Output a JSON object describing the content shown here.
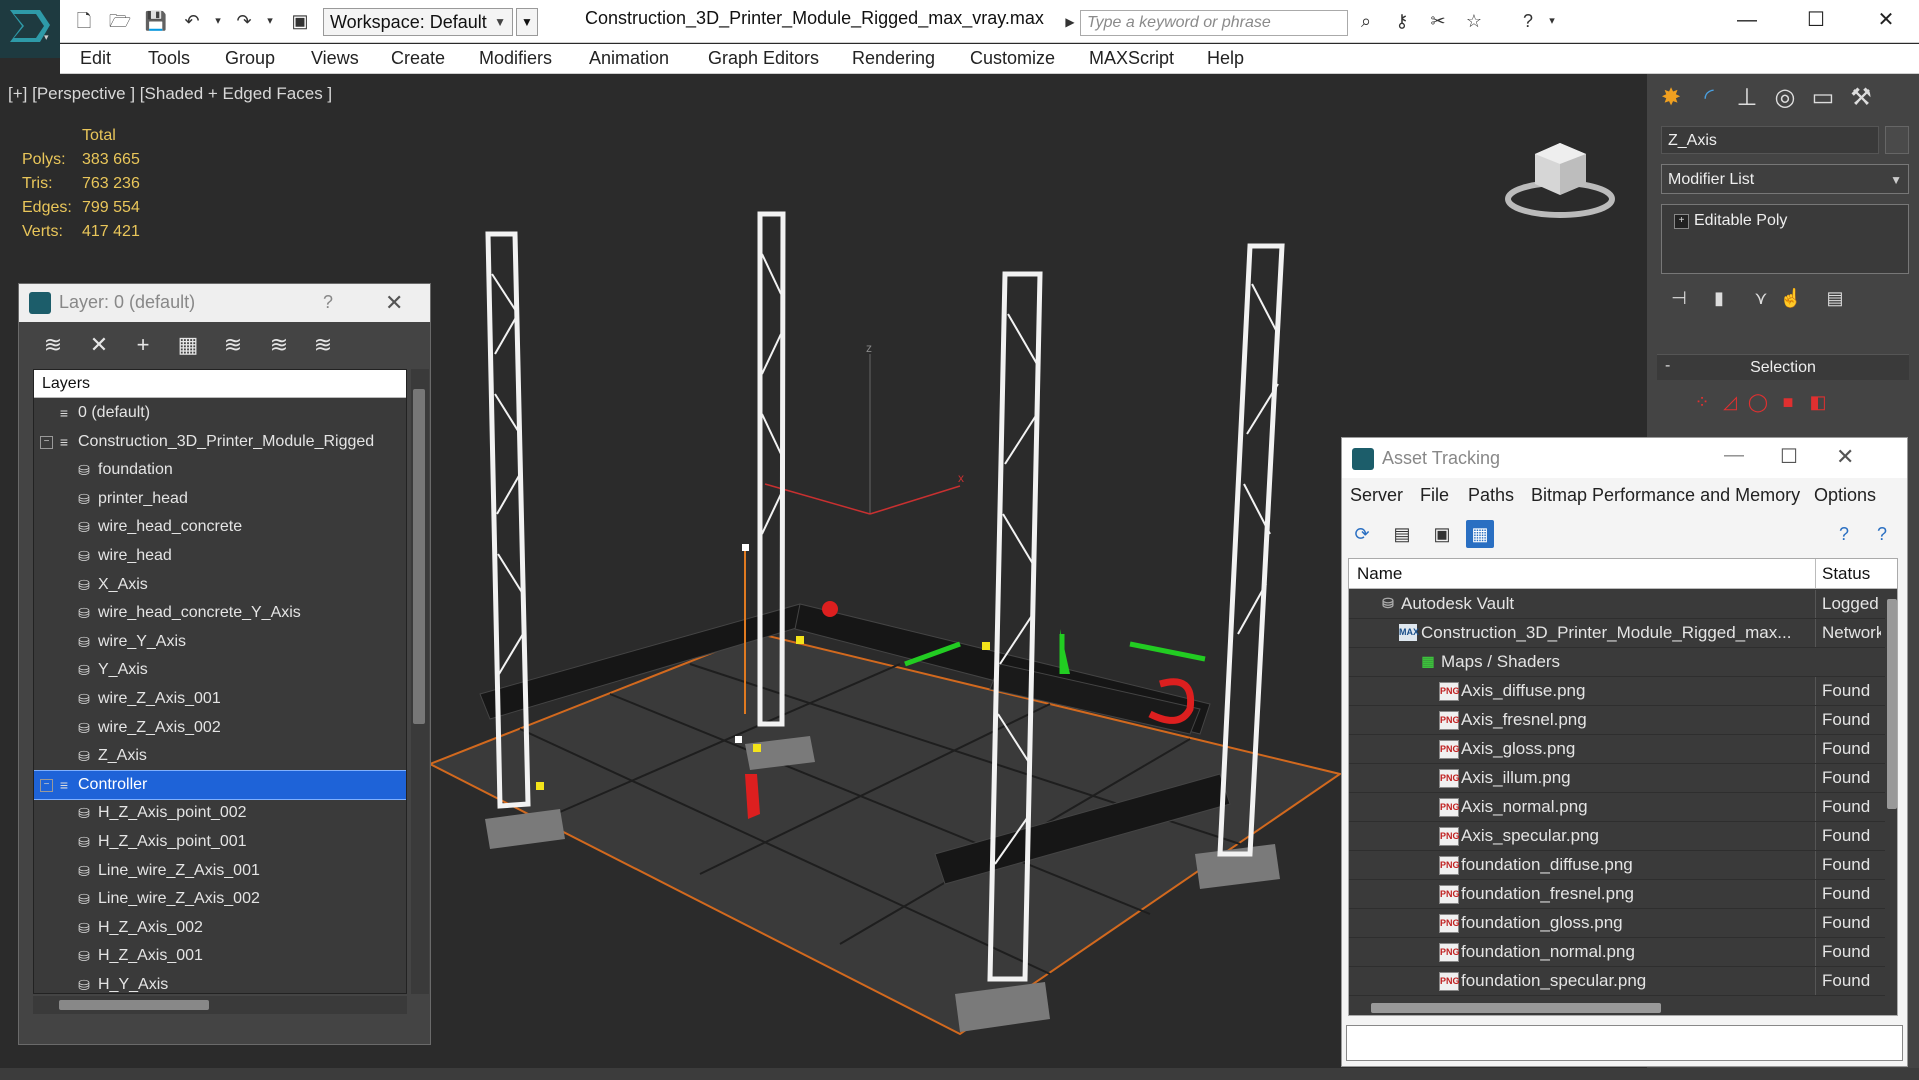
{
  "app": {
    "document_title": "Construction_3D_Printer_Module_Rigged_max_vray.max",
    "workspace": "Workspace: Default",
    "search_placeholder": "Type a keyword or phrase"
  },
  "menu": [
    "Edit",
    "Tools",
    "Group",
    "Views",
    "Create",
    "Modifiers",
    "Animation",
    "Graph Editors",
    "Rendering",
    "Customize",
    "MAXScript",
    "Help"
  ],
  "viewport": {
    "label": "[+] [Perspective ] [Shaded + Edged Faces ]",
    "stats_header": "Total",
    "stats": [
      {
        "key": "Polys:",
        "value": "383 665"
      },
      {
        "key": "Tris:",
        "value": "763 236"
      },
      {
        "key": "Edges:",
        "value": "799 554"
      },
      {
        "key": "Verts:",
        "value": "417 421"
      }
    ],
    "axis_z": "z",
    "axis_x": "x"
  },
  "layer_dialog": {
    "title": "Layer: 0 (default)",
    "help": "?",
    "column": "Layers",
    "rows": [
      {
        "label": "0 (default)",
        "level": 0,
        "expander": "",
        "selected": false
      },
      {
        "label": "Construction_3D_Printer_Module_Rigged",
        "level": 0,
        "expander": "−",
        "selected": false
      },
      {
        "label": "foundation",
        "level": 1,
        "expander": "",
        "selected": false
      },
      {
        "label": "printer_head",
        "level": 1,
        "expander": "",
        "selected": false
      },
      {
        "label": "wire_head_concrete",
        "level": 1,
        "expander": "",
        "selected": false
      },
      {
        "label": "wire_head",
        "level": 1,
        "expander": "",
        "selected": false
      },
      {
        "label": "X_Axis",
        "level": 1,
        "expander": "",
        "selected": false
      },
      {
        "label": "wire_head_concrete_Y_Axis",
        "level": 1,
        "expander": "",
        "selected": false
      },
      {
        "label": "wire_Y_Axis",
        "level": 1,
        "expander": "",
        "selected": false
      },
      {
        "label": "Y_Axis",
        "level": 1,
        "expander": "",
        "selected": false
      },
      {
        "label": "wire_Z_Axis_001",
        "level": 1,
        "expander": "",
        "selected": false
      },
      {
        "label": "wire_Z_Axis_002",
        "level": 1,
        "expander": "",
        "selected": false
      },
      {
        "label": "Z_Axis",
        "level": 1,
        "expander": "",
        "selected": false
      },
      {
        "label": "Controller",
        "level": 0,
        "expander": "−",
        "selected": true
      },
      {
        "label": "H_Z_Axis_point_002",
        "level": 1,
        "expander": "",
        "selected": false
      },
      {
        "label": "H_Z_Axis_point_001",
        "level": 1,
        "expander": "",
        "selected": false
      },
      {
        "label": "Line_wire_Z_Axis_001",
        "level": 1,
        "expander": "",
        "selected": false
      },
      {
        "label": "Line_wire_Z_Axis_002",
        "level": 1,
        "expander": "",
        "selected": false
      },
      {
        "label": "H_Z_Axis_002",
        "level": 1,
        "expander": "",
        "selected": false
      },
      {
        "label": "H_Z_Axis_001",
        "level": 1,
        "expander": "",
        "selected": false
      },
      {
        "label": "H_Y_Axis",
        "level": 1,
        "expander": "",
        "selected": false
      }
    ]
  },
  "command_panel": {
    "object_name": "Z_Axis",
    "modifier_list": "Modifier List",
    "stack_item": "Editable Poly",
    "selection_rollout": "Selection"
  },
  "asset_tracking": {
    "title": "Asset Tracking",
    "menu": [
      "Server",
      "File",
      "Paths",
      "Bitmap Performance and Memory",
      "Options"
    ],
    "columns": {
      "name": "Name",
      "status": "Status"
    },
    "rows": [
      {
        "name": "Autodesk Vault",
        "status": "Logged",
        "indent": 0,
        "icon": "vault"
      },
      {
        "name": "Construction_3D_Printer_Module_Rigged_max...",
        "status": "Network",
        "indent": 1,
        "icon": "max"
      },
      {
        "name": "Maps / Shaders",
        "status": "",
        "indent": 2,
        "icon": "maps"
      },
      {
        "name": "Axis_diffuse.png",
        "status": "Found",
        "indent": 3,
        "icon": "png"
      },
      {
        "name": "Axis_fresnel.png",
        "status": "Found",
        "indent": 3,
        "icon": "png"
      },
      {
        "name": "Axis_gloss.png",
        "status": "Found",
        "indent": 3,
        "icon": "png"
      },
      {
        "name": "Axis_illum.png",
        "status": "Found",
        "indent": 3,
        "icon": "png"
      },
      {
        "name": "Axis_normal.png",
        "status": "Found",
        "indent": 3,
        "icon": "png"
      },
      {
        "name": "Axis_specular.png",
        "status": "Found",
        "indent": 3,
        "icon": "png"
      },
      {
        "name": "foundation_diffuse.png",
        "status": "Found",
        "indent": 3,
        "icon": "png"
      },
      {
        "name": "foundation_fresnel.png",
        "status": "Found",
        "indent": 3,
        "icon": "png"
      },
      {
        "name": "foundation_gloss.png",
        "status": "Found",
        "indent": 3,
        "icon": "png"
      },
      {
        "name": "foundation_normal.png",
        "status": "Found",
        "indent": 3,
        "icon": "png"
      },
      {
        "name": "foundation_specular.png",
        "status": "Found",
        "indent": 3,
        "icon": "png"
      }
    ]
  },
  "colors": {
    "stats_text": "#e9c65a",
    "selection_blue": "#1e63d8",
    "viewport_bg": "#2b2b2b",
    "grid_boundary": "#d2691e"
  }
}
